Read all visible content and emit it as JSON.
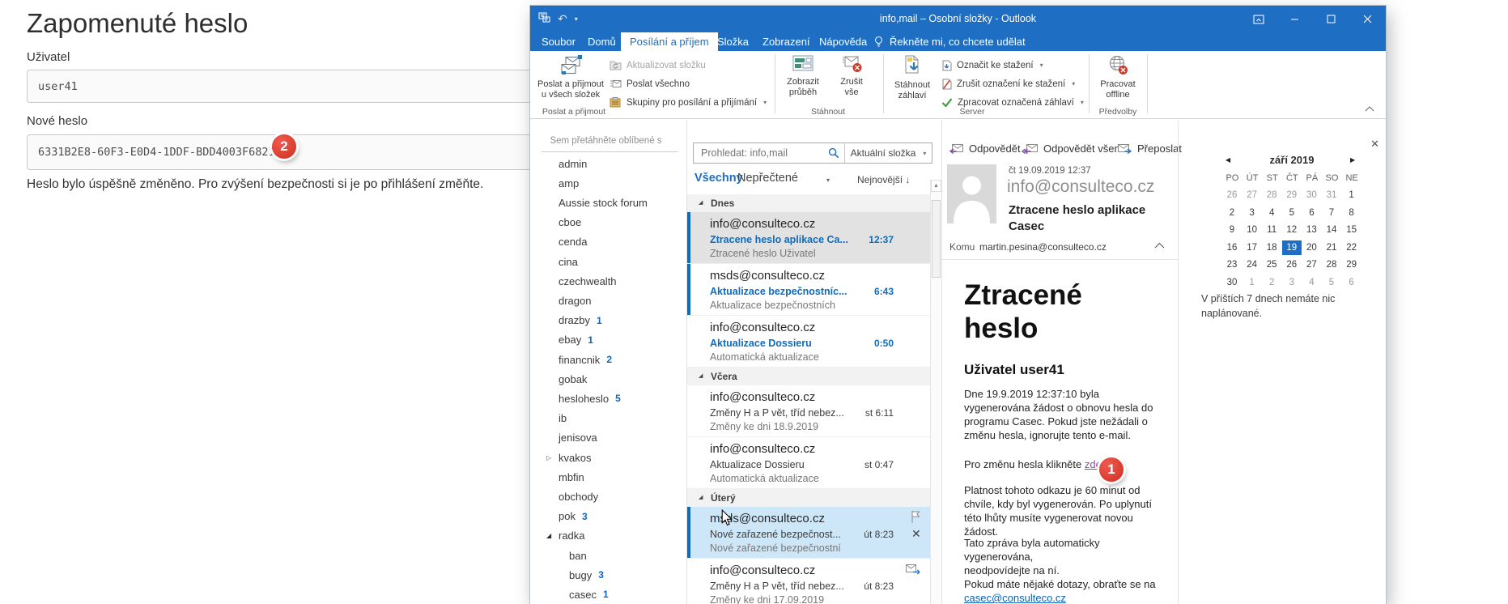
{
  "webpage": {
    "title": "Zapomenuté heslo",
    "user_label": "Uživatel",
    "user_value": "user41",
    "password_label": "Nové heslo",
    "password_value": "6331B2E8-60F3-E0D4-1DDF-BDD4003F6821",
    "message": "Heslo bylo úspěšně změněno. Pro zvýšení bezpečnosti si je po přihlášení změňte."
  },
  "annotations": {
    "badge1": "1",
    "badge2": "2"
  },
  "outlook": {
    "colors": {
      "titlebar": "#1e6fc4",
      "unread": "#0e6cbd",
      "badge": "#da3b2b",
      "link_blue": "#0563c1",
      "link_purple": "#8e4aa5"
    },
    "titlebar": {
      "title": "info,mail – Osobní složky  -  Outlook"
    },
    "tabs": [
      {
        "label": "Soubor"
      },
      {
        "label": "Domů"
      },
      {
        "label": "Posílání a příjem",
        "active": true
      },
      {
        "label": "Složka"
      },
      {
        "label": "Zobrazení"
      },
      {
        "label": "Nápověda"
      }
    ],
    "tell_me": "Řekněte mi, co chcete udělat",
    "ribbon": {
      "send_receive_all": {
        "line1": "Poslat a přijmout",
        "line2": "u všech složek"
      },
      "update_folder": "Aktualizovat složku",
      "send_all": "Poslat všechno",
      "send_groups": "Skupiny pro posílání a přijímání",
      "show_progress": {
        "line1": "Zobrazit",
        "line2": "průběh"
      },
      "cancel_all": {
        "line1": "Zrušit",
        "line2": "vše"
      },
      "download_headers": {
        "line1": "Stáhnout",
        "line2": "záhlaví"
      },
      "mark_download": "Označit ke stažení",
      "unmark_download": "Zrušit označení ke stažení",
      "process_marked": "Zpracovat označená záhlaví",
      "work_offline": {
        "line1": "Pracovat",
        "line2": "offline"
      },
      "captions": {
        "send_receive": "Poslat a přijmout",
        "download": "Stáhnout",
        "server": "Server",
        "preferences": "Předvolby"
      }
    },
    "folder_pane": {
      "favorites_hint": "Sem přetáhněte oblíbené s",
      "items": [
        {
          "name": "admin"
        },
        {
          "name": "amp"
        },
        {
          "name": "Aussie stock forum"
        },
        {
          "name": "cboe"
        },
        {
          "name": "cenda"
        },
        {
          "name": "cina"
        },
        {
          "name": "czechwealth"
        },
        {
          "name": "dragon"
        },
        {
          "name": "drazby",
          "count": "1"
        },
        {
          "name": "ebay",
          "count": "1"
        },
        {
          "name": "financnik",
          "count": "2"
        },
        {
          "name": "gobak"
        },
        {
          "name": "hesloheslo",
          "count": "5"
        },
        {
          "name": "ib"
        },
        {
          "name": "jenisova"
        },
        {
          "name": "kvakos",
          "arrow": "collapsed"
        },
        {
          "name": "mbfin"
        },
        {
          "name": "obchody"
        },
        {
          "name": "pok",
          "count": "3"
        },
        {
          "name": "radka",
          "arrow": "expanded"
        },
        {
          "name": "ban",
          "indent": 1
        },
        {
          "name": "bugy",
          "count": "3",
          "indent": 1
        },
        {
          "name": "casec",
          "count": "1",
          "indent": 1
        }
      ]
    },
    "mail_list": {
      "search_placeholder": "Prohledat: info,mail",
      "scope": "Aktuální složka",
      "filter_all": "Všechny",
      "filter_unread": "Nepřečtené",
      "sort_label": "Nejnovější",
      "groups": [
        {
          "label": "Dnes",
          "items": [
            {
              "from": "info@consulteco.cz",
              "subject": "Ztracene heslo aplikace Ca...",
              "time": "12:37",
              "preview": "Ztracené heslo  Uživatel",
              "unread": true,
              "bar": true,
              "selected": true
            },
            {
              "from": "msds@consulteco.cz",
              "subject": "Aktualizace bezpečnostníc...",
              "time": "6:43",
              "preview": "Aktualizace bezpečnostních",
              "unread": true,
              "bar": true
            },
            {
              "from": "info@consulteco.cz",
              "subject": "Aktualizace Dossieru",
              "time": "0:50",
              "preview": "Automatická aktualizace",
              "unread": true
            }
          ]
        },
        {
          "label": "Včera",
          "items": [
            {
              "from": "info@consulteco.cz",
              "subject": "Změny H a P vět, tříd nebez...",
              "time": "st 6:11",
              "preview": "Změny ke dni 18.9.2019"
            },
            {
              "from": "info@consulteco.cz",
              "subject": "Aktualizace Dossieru",
              "time": "st 0:47",
              "preview": "Automatická aktualizace"
            }
          ]
        },
        {
          "label": "Úterý",
          "items": [
            {
              "from": "msds@consulteco.cz",
              "subject": "Nové zařazené bezpečnost...",
              "time": "út 8:23",
              "preview": "Nové zařazené bezpečnostní",
              "bar": true,
              "hover": true
            },
            {
              "from": "info@consulteco.cz",
              "subject": "Změny H a P vět, tříd nebez...",
              "time": "út 8:23",
              "preview": "Změny ke dni 17.09.2019"
            }
          ]
        }
      ]
    },
    "reading_pane": {
      "reply": "Odpovědět",
      "reply_all": "Odpovědět všem",
      "forward": "Přeposlat",
      "date": "čt 19.09.2019 12:37",
      "from": "info@consulteco.cz",
      "subject": "Ztracene heslo aplikace Casec",
      "to_label": "Komu",
      "to_value": "martin.pesina@consulteco.cz",
      "body": {
        "heading": "Ztracené heslo",
        "subheading": "Uživatel user41",
        "p1": "Dne 19.9.2019 12:37:10 byla vygenerována žádost o obnovu hesla do programu Casec. Pokud jste nežádali o změnu hesla, ignorujte tento e-mail.",
        "p2_text": "Pro změnu hesla klikněte ",
        "p2_link": "zde",
        "p3": "Platnost tohoto odkazu je 60 minut od chvíle, kdy byl vygenerován. Po uplynutí této lhůty musíte vygenerovat novou žádost.",
        "p4_line1": "Tato zpráva byla automaticky vygenerována,",
        "p4_line2": "neodpovídejte na ní.",
        "p4_line3": "Pokud máte nějaké dotazy, obraťte se na",
        "p4_link": "casec@consulteco.cz"
      }
    },
    "calendar": {
      "month_label": "září 2019",
      "weekdays": [
        "PO",
        "ÚT",
        "ST",
        "ČT",
        "PÁ",
        "SO",
        "NE"
      ],
      "rows": [
        [
          "26",
          "27",
          "28",
          "29",
          "30",
          "31",
          "1"
        ],
        [
          "2",
          "3",
          "4",
          "5",
          "6",
          "7",
          "8"
        ],
        [
          "9",
          "10",
          "11",
          "12",
          "13",
          "14",
          "15"
        ],
        [
          "16",
          "17",
          "18",
          "19",
          "20",
          "21",
          "22"
        ],
        [
          "23",
          "24",
          "25",
          "26",
          "27",
          "28",
          "29"
        ],
        [
          "30",
          "1",
          "2",
          "3",
          "4",
          "5",
          "6"
        ]
      ],
      "selected_cell": [
        3,
        3
      ],
      "muted_cells": [
        [
          0,
          0
        ],
        [
          0,
          1
        ],
        [
          0,
          2
        ],
        [
          0,
          3
        ],
        [
          0,
          4
        ],
        [
          0,
          5
        ],
        [
          5,
          1
        ],
        [
          5,
          2
        ],
        [
          5,
          3
        ],
        [
          5,
          4
        ],
        [
          5,
          5
        ],
        [
          5,
          6
        ]
      ],
      "note": "V příštích 7 dnech nemáte nic naplánované."
    }
  }
}
